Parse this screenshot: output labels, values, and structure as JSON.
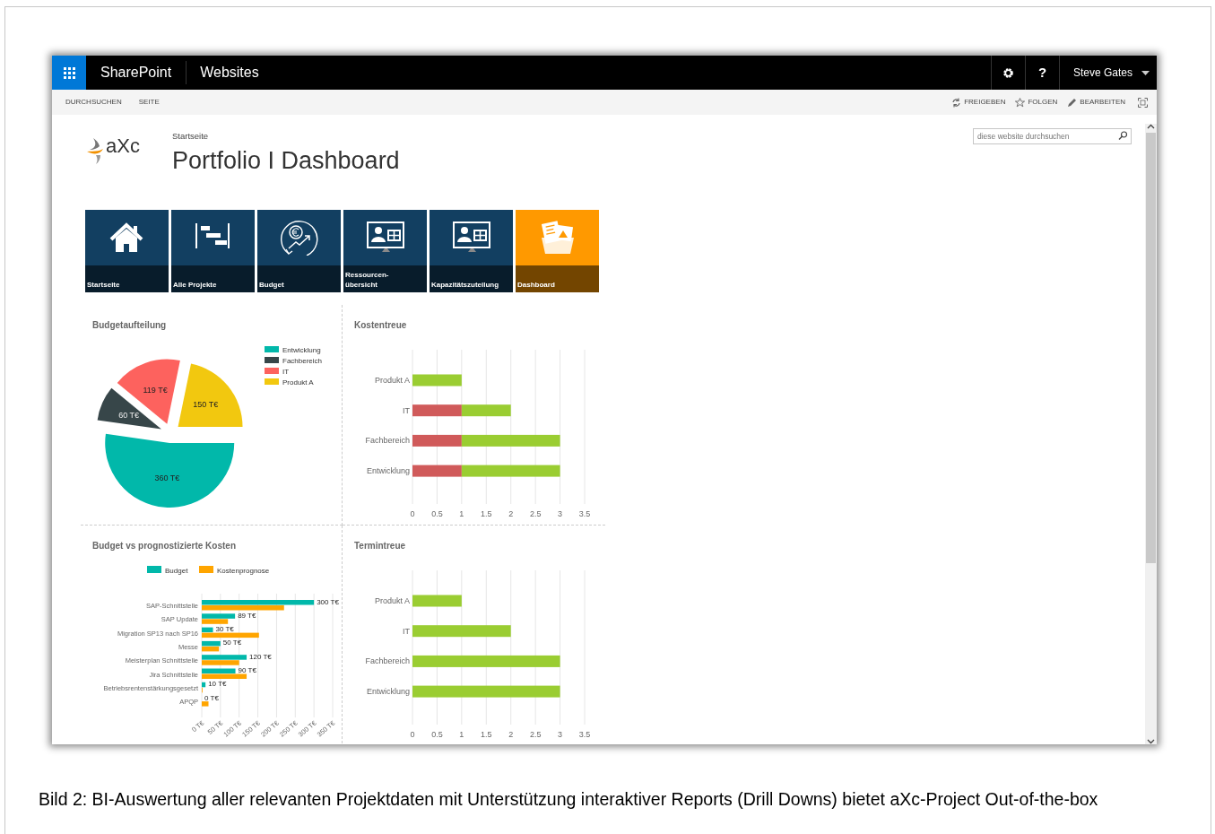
{
  "suite_bar": {
    "brand": "SharePoint",
    "section": "Websites",
    "help": "?",
    "user": "Steve Gates"
  },
  "ribbon": {
    "tabs": [
      {
        "label": "DURCHSUCHEN"
      },
      {
        "label": "SEITE"
      }
    ],
    "actions": [
      {
        "label": "FREIGEBEN",
        "kind": "share"
      },
      {
        "label": "FOLGEN",
        "kind": "follow"
      },
      {
        "label": "BEARBEITEN",
        "kind": "edit"
      },
      {
        "kind": "focus"
      }
    ]
  },
  "header": {
    "logo_text": "aXc",
    "breadcrumb": "Startseite",
    "title": "Portfolio I Dashboard",
    "search": {
      "placeholder": "diese website durchsuchen"
    }
  },
  "tiles": [
    {
      "label": "Startseite",
      "kind": "home",
      "selected": false
    },
    {
      "label": "Alle Projekte",
      "kind": "gantt",
      "selected": false
    },
    {
      "label": "Budget",
      "kind": "budget",
      "selected": false
    },
    {
      "label": "Ressourcen-\nübersicht",
      "kind": "screen",
      "selected": false
    },
    {
      "label": "Kapazitätszuteilung",
      "kind": "screen",
      "selected": false
    },
    {
      "label": "Dashboard",
      "kind": "folder",
      "selected": true
    }
  ],
  "panels": [
    {
      "title": "Budgetaufteilung",
      "chart_data": {
        "type": "pie",
        "categories": [
          "Entwicklung",
          "Fachbereich",
          "IT",
          "Produkt A"
        ],
        "values": [
          360,
          60,
          119,
          150
        ],
        "colors": [
          "#01b8aa",
          "#374649",
          "#fd625e",
          "#f2c80f"
        ],
        "legend": true,
        "value_labels": [
          "360 T€",
          "60 T€",
          "119 T€",
          "150 T€"
        ]
      }
    },
    {
      "title": "Kostentreue",
      "chart_data": {
        "type": "bar",
        "orientation": "horizontal",
        "stacked": true,
        "categories": [
          "Produkt A",
          "IT",
          "Fachbereich",
          "Entwicklung"
        ],
        "series": [
          {
            "color": "#d05a5a",
            "values": [
              0,
              1,
              1,
              1
            ]
          },
          {
            "color": "#9acd32",
            "values": [
              1,
              1,
              2,
              2
            ]
          }
        ],
        "grid": true,
        "xlim": [
          0,
          3.5
        ],
        "xticks": [
          0,
          0.5,
          1,
          1.5,
          2,
          2.5,
          3,
          3.5
        ]
      }
    },
    {
      "title": "Budget vs prognostizierte Kosten",
      "chart_data": {
        "type": "bar",
        "orientation": "horizontal",
        "stacked": false,
        "categories": [
          "SAP-Schnittstelle",
          "SAP Update",
          "Migration SP13 nach SP16",
          "Messe",
          "Meisterplan Schnittstelle",
          "Jira Schnittstelle",
          "Betriebsrentenstärkungsgesetzt",
          "APQP"
        ],
        "series": [
          {
            "name": "Budget",
            "color": "#01b8aa",
            "values": [
              300,
              89,
              30,
              50,
              120,
              90,
              10,
              0
            ]
          },
          {
            "name": "Kostenprognose",
            "color": "#ffa500",
            "values": [
              220,
              70,
              153,
              46,
              100,
              120,
              2,
              18
            ]
          }
        ],
        "legend": true,
        "grid": true,
        "xlim": [
          0,
          350
        ],
        "xticks": [
          {
            "value": 0,
            "label": "0 T€"
          },
          {
            "value": 50,
            "label": "50 T€"
          },
          {
            "value": 100,
            "label": "100 T€"
          },
          {
            "value": 150,
            "label": "150 T€"
          },
          {
            "value": 200,
            "label": "200 T€"
          },
          {
            "value": 250,
            "label": "250 T€"
          },
          {
            "value": 300,
            "label": "300 T€"
          },
          {
            "value": 350,
            "label": "350 T€"
          }
        ],
        "value_labels": [
          "300 T€",
          "89 T€",
          "30 T€",
          "50 T€",
          "120 T€",
          "90 T€",
          "10 T€",
          "0 T€"
        ]
      }
    },
    {
      "title": "Termintreue",
      "chart_data": {
        "type": "bar",
        "orientation": "horizontal",
        "stacked": true,
        "categories": [
          "Produkt A",
          "IT",
          "Fachbereich",
          "Entwicklung"
        ],
        "series": [
          {
            "color": "#9acd32",
            "values": [
              1,
              2,
              3,
              3
            ]
          }
        ],
        "grid": true,
        "xlim": [
          0,
          3.5
        ],
        "xticks": [
          0,
          0.5,
          1,
          1.5,
          2,
          2.5,
          3,
          3.5
        ]
      }
    }
  ],
  "caption": "Bild 2: BI-Auswertung aller relevanten Projektdaten mit Unterstützung interaktiver Reports (Drill Downs) bietet aXc-Project Out-of-the-box"
}
